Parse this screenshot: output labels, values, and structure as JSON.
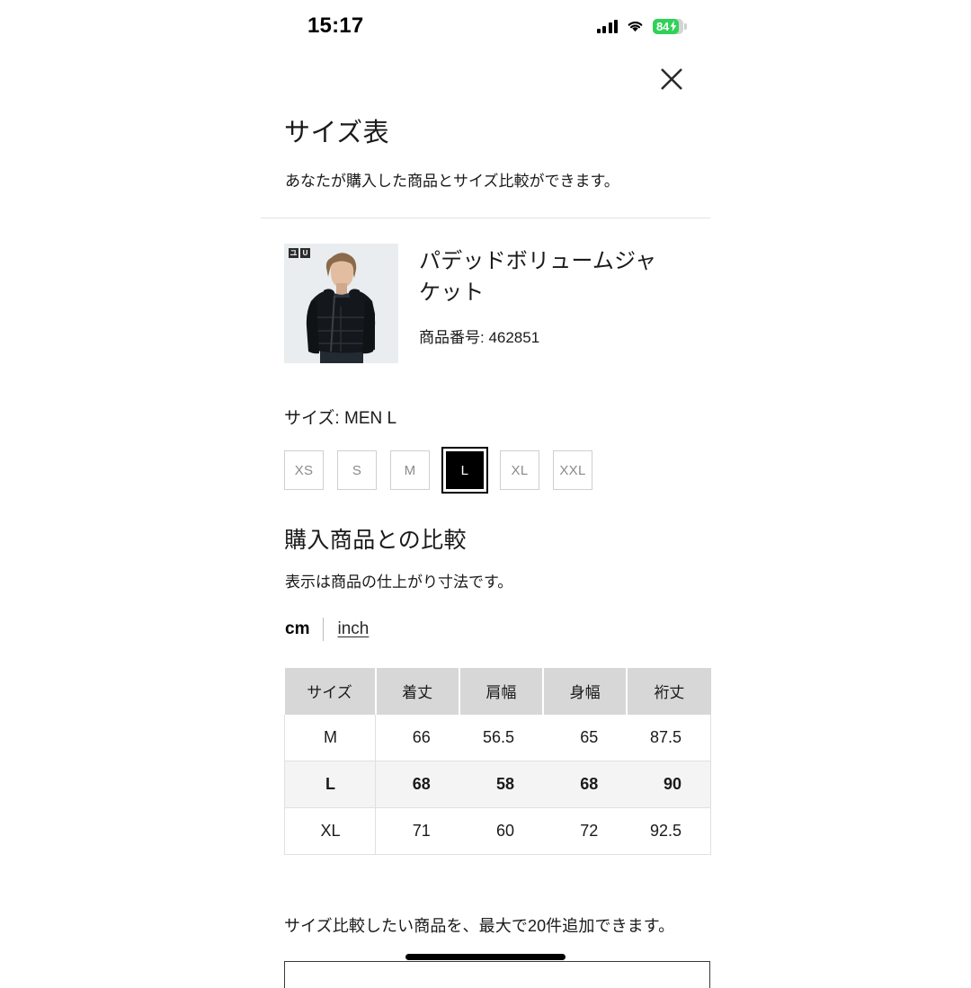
{
  "status_bar": {
    "time": "15:17",
    "battery_percent": "84",
    "icons": [
      "signal-icon",
      "wifi-icon",
      "battery-icon"
    ]
  },
  "header": {
    "close_label": "×",
    "title": "サイズ表",
    "subtitle": "あなたが購入した商品とサイズ比較ができます。"
  },
  "product": {
    "name": "パデッドボリュームジャケット",
    "code_label": "商品番号: 462851",
    "thumbnail_brand": [
      "ユニ",
      "U"
    ]
  },
  "size_selector": {
    "label": "サイズ: MEN L",
    "options": [
      "XS",
      "S",
      "M",
      "L",
      "XL",
      "XXL"
    ],
    "selected": "L"
  },
  "comparison": {
    "title": "購入商品との比較",
    "subtitle": "表示は商品の仕上がり寸法です。",
    "unit_active": "cm",
    "unit_inactive": "inch"
  },
  "chart_data": {
    "type": "table",
    "title": "購入商品との比較",
    "columns": [
      "サイズ",
      "着丈",
      "肩幅",
      "身幅",
      "裄丈"
    ],
    "unit": "cm",
    "highlighted_row": "L",
    "rows": [
      {
        "size": "M",
        "values": [
          "66",
          "56.5",
          "65",
          "87.5"
        ]
      },
      {
        "size": "L",
        "values": [
          "68",
          "58",
          "68",
          "90"
        ]
      },
      {
        "size": "XL",
        "values": [
          "71",
          "60",
          "72",
          "92.5"
        ]
      }
    ]
  },
  "footer": {
    "note": "サイズ比較したい商品を、最大で20件追加できます。"
  }
}
